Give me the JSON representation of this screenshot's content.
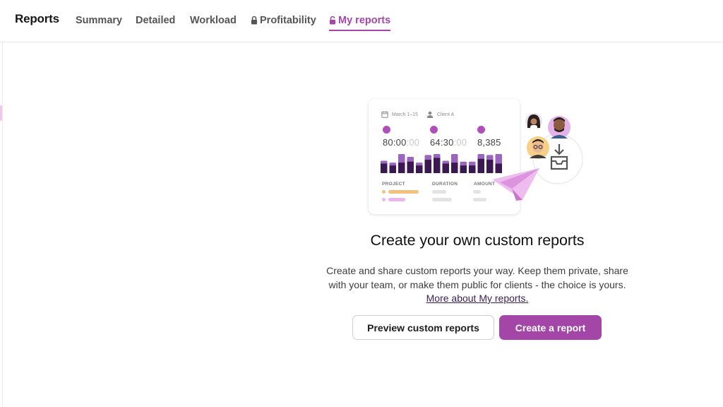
{
  "header": {
    "title": "Reports",
    "tabs": [
      {
        "label": "Summary",
        "locked": false,
        "active": false
      },
      {
        "label": "Detailed",
        "locked": false,
        "active": false
      },
      {
        "label": "Workload",
        "locked": false,
        "active": false
      },
      {
        "label": "Profitability",
        "locked": true,
        "active": false
      },
      {
        "label": "My reports",
        "locked": true,
        "active": true
      }
    ]
  },
  "illustration": {
    "date_range": "March 1–15",
    "client": "Client A",
    "stats": [
      {
        "icon": "clock-icon",
        "main": "80:00",
        "faded": ":00"
      },
      {
        "icon": "dollar-icon",
        "main": "64:30",
        "faded": ":00"
      },
      {
        "icon": "database-icon",
        "main": "8,385",
        "faded": ""
      }
    ],
    "columns": [
      "PROJECT",
      "DURATION",
      "AMOUNT"
    ],
    "bars": [
      {
        "total": 0.65,
        "dark": 0.5
      },
      {
        "total": 0.55,
        "dark": 0.4
      },
      {
        "total": 1.0,
        "dark": 0.55
      },
      {
        "total": 0.85,
        "dark": 0.6
      },
      {
        "total": 0.55,
        "dark": 0.4
      },
      {
        "total": 0.95,
        "dark": 0.7
      },
      {
        "total": 1.0,
        "dark": 0.8
      },
      {
        "total": 0.65,
        "dark": 0.5
      },
      {
        "total": 1.0,
        "dark": 0.55
      },
      {
        "total": 0.6,
        "dark": 0.4
      },
      {
        "total": 0.6,
        "dark": 0.4
      },
      {
        "total": 1.0,
        "dark": 0.75
      },
      {
        "total": 0.95,
        "dark": 0.7
      },
      {
        "total": 1.0,
        "dark": 0.5
      }
    ]
  },
  "main": {
    "heading": "Create your own custom reports",
    "description": "Create and share custom reports your way. Keep them private, share with your team, or make them public for clients - the choice is yours.",
    "link_text": "More about My reports.",
    "preview_button": "Preview custom reports",
    "create_button": "Create a report"
  },
  "colors": {
    "accent": "#a346a8",
    "bar_light": "#9b66bd",
    "bar_dark": "#3b1852",
    "card_orange": "#f3c17c",
    "card_pink": "#ebb7ea",
    "plane": "#e8aeea"
  }
}
